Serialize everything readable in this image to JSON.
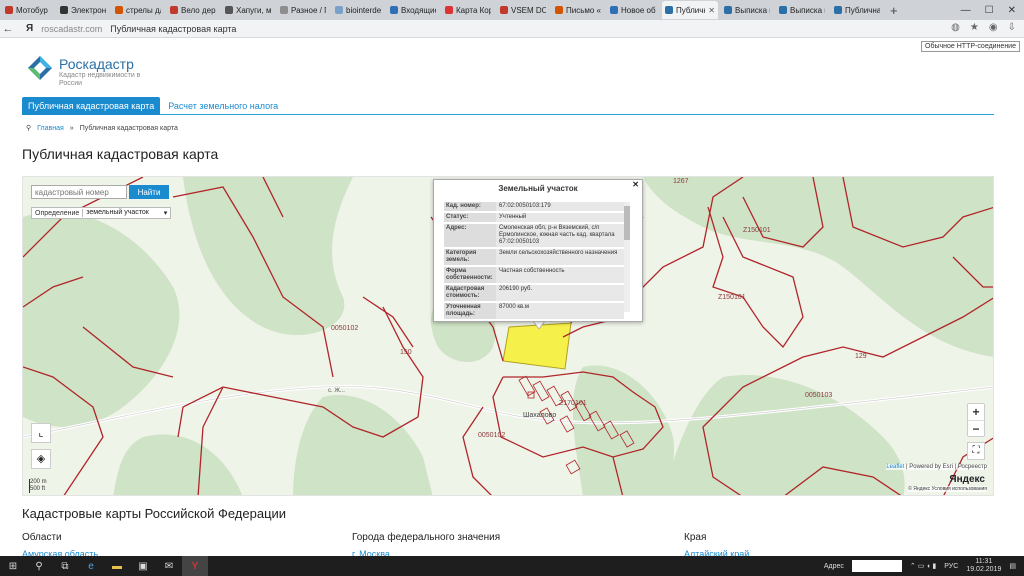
{
  "browser": {
    "tabs": [
      {
        "label": "Мотобур",
        "color": "#c0392b"
      },
      {
        "label": "Электрон",
        "color": "#333333"
      },
      {
        "label": "стрелы дл",
        "color": "#d35400"
      },
      {
        "label": "Вело дер",
        "color": "#c0392b"
      },
      {
        "label": "Хапуги, м",
        "color": "#555555"
      },
      {
        "label": "Разное / Г",
        "color": "#8e8e8e"
      },
      {
        "label": "biointerde",
        "color": "#7aa2c8"
      },
      {
        "label": "Входящие",
        "color": "#2f6fb5"
      },
      {
        "label": "Карта Кор",
        "color": "#d33"
      },
      {
        "label": "VSEM DOV",
        "color": "#c0392b"
      },
      {
        "label": "Письмо «",
        "color": "#d35400"
      },
      {
        "label": "Новое об",
        "color": "#2f6fb5"
      },
      {
        "label": "Публичн",
        "color": "#2a6fa6",
        "active": true
      },
      {
        "label": "Выписка и",
        "color": "#2a6fa6"
      },
      {
        "label": "Выписка и",
        "color": "#2a6fa6"
      },
      {
        "label": "Публичная",
        "color": "#2a6fa6"
      }
    ],
    "new_tab": "+",
    "url": "roscadastr.com",
    "page_title": "Публичная кадастровая карта",
    "yandex": "Я",
    "tooltip": "Обычное HTTP-соединение"
  },
  "site": {
    "brand": "Роскадастр",
    "brand_sub": "Кадастр недвижимости в России",
    "nav_active": "Публичная кадастровая карта",
    "nav_link": "Расчет земельного налога",
    "breadcrumb_home": "Главная",
    "breadcrumb_current": "Публичная кадастровая карта",
    "title": "Публичная кадастровая карта"
  },
  "map": {
    "search_placeholder": "кадастровый номер",
    "search_button": "Найти",
    "def_label": "Определение",
    "def_value": "земельный участок",
    "popup_title": "Земельный участок",
    "popup_close": "✕",
    "popup_rows": [
      {
        "k": "Кад. номер:",
        "v": "67:02:0050103:179"
      },
      {
        "k": "Статус:",
        "v": "Учтенный"
      },
      {
        "k": "Адрес:",
        "v": "Смоленская обл, р-н Вяземский, с/п Ермолинское, южная часть кад. квартала 67:02:0050103"
      },
      {
        "k": "Категория земель:",
        "v": "Земли сельскохозяйственного назначения"
      },
      {
        "k": "Форма собственности:",
        "v": "Частная собственность"
      },
      {
        "k": "Кадастровая стоимость:",
        "v": "206190 руб."
      },
      {
        "k": "Уточненная площадь:",
        "v": "87000 кв.м"
      }
    ],
    "labels": {
      "l1": "Z150101",
      "l2": "Z150101",
      "l3": "0050102",
      "l4": "Z170101",
      "l5": "0050102",
      "l6": "0050103",
      "l7": "150",
      "l8": "1267",
      "l9": "129",
      "l10": "Шахалово",
      "l11": "с. Ж..."
    },
    "zoom_in": "+",
    "zoom_out": "−",
    "scale_m": "200 m",
    "scale_ft": "500 ft",
    "attribution_leaflet": "Leaflet",
    "attribution_rest": "| Powered by Esri | Росреестр",
    "yandex_logo": "Яндекс",
    "yandex_terms": "© Яндекс  Условия использования"
  },
  "section": {
    "title": "Кадастровые карты Российской Федерации",
    "col1_title": "Области",
    "col1_link": "Амурская область",
    "col2_title": "Города федерального значения",
    "col2_link": "г. Москва",
    "col3_title": "Края",
    "col3_link": "Алтайский край"
  },
  "taskbar": {
    "lang": "РУС",
    "time": "11:31",
    "date": "19.02.2019",
    "address_label": "Адрес"
  },
  "colors": {
    "accent": "#1b8bd0",
    "parcel_border": "#b0252a",
    "highlight": "#f6f04a"
  }
}
